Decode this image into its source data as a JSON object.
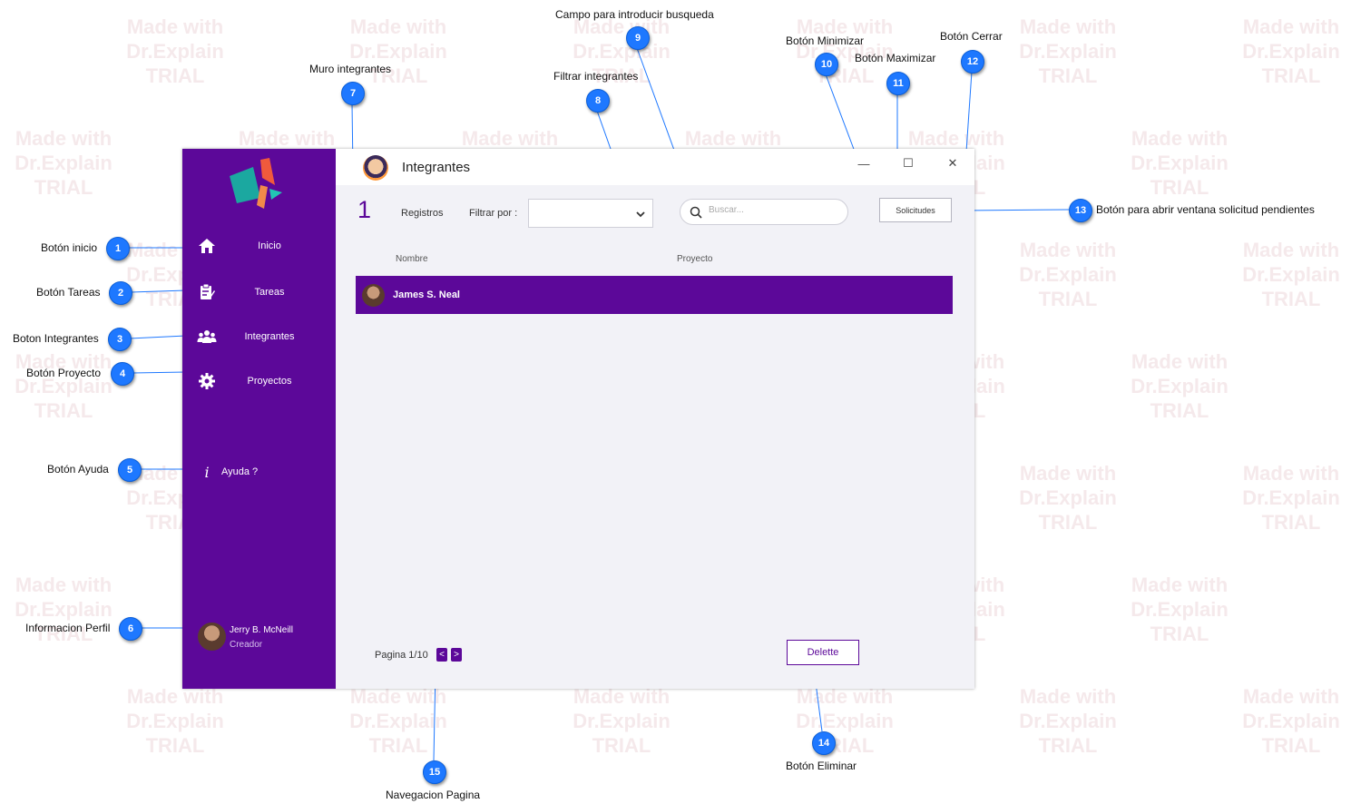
{
  "watermark": {
    "line1": "Made with",
    "line2": "Dr.Explain",
    "line3": "TRIAL"
  },
  "callouts": [
    {
      "n": "1",
      "label": "Botón inicio"
    },
    {
      "n": "2",
      "label": "Botón Tareas"
    },
    {
      "n": "3",
      "label": "Boton Integrantes"
    },
    {
      "n": "4",
      "label": "Botón Proyecto"
    },
    {
      "n": "5",
      "label": "Botón Ayuda"
    },
    {
      "n": "6",
      "label": "Informacion Perfil"
    },
    {
      "n": "7",
      "label": "Muro integrantes"
    },
    {
      "n": "8",
      "label": "Filtrar integrantes"
    },
    {
      "n": "9",
      "label": "Campo para introducir busqueda"
    },
    {
      "n": "10",
      "label": "Botón Minimizar"
    },
    {
      "n": "11",
      "label": "Botón Maximizar"
    },
    {
      "n": "12",
      "label": "Botón Cerrar"
    },
    {
      "n": "13",
      "label": "Botón para abrir ventana solicitud pendientes"
    },
    {
      "n": "14",
      "label": "Botón Eliminar"
    },
    {
      "n": "15",
      "label": "Navegacion Pagina"
    }
  ],
  "app": {
    "title": "Integrantes",
    "minimize_glyph": "—",
    "maximize_glyph": "☐",
    "close_glyph": "✕",
    "colors": {
      "sidebar": "#5c0899",
      "accent": "#5c0899",
      "content_bg": "#f2f2f7"
    }
  },
  "sidebar": {
    "items": [
      {
        "label": "Inicio",
        "icon": "home-icon"
      },
      {
        "label": "Tareas",
        "icon": "tasks-icon"
      },
      {
        "label": "Integrantes",
        "icon": "group-icon"
      },
      {
        "label": "Proyectos",
        "icon": "gear-icon"
      }
    ],
    "help": {
      "label": "Ayuda ?",
      "icon": "info-icon"
    },
    "profile": {
      "name": "Jerry B. McNeill",
      "role": "Creador"
    }
  },
  "toolbar": {
    "count": "1",
    "registros_label": "Registros",
    "filter_label": "Filtrar por :",
    "filter_value": "",
    "search_placeholder": "Buscar...",
    "requests_button": "Solicitudes"
  },
  "table": {
    "columns": [
      "Nombre",
      "Proyecto"
    ],
    "rows": [
      {
        "name": "James S. Neal",
        "project": ""
      }
    ]
  },
  "footer": {
    "page_text": "Pagina 1/10",
    "prev": "<",
    "next": ">",
    "delete_button": "Delette"
  }
}
